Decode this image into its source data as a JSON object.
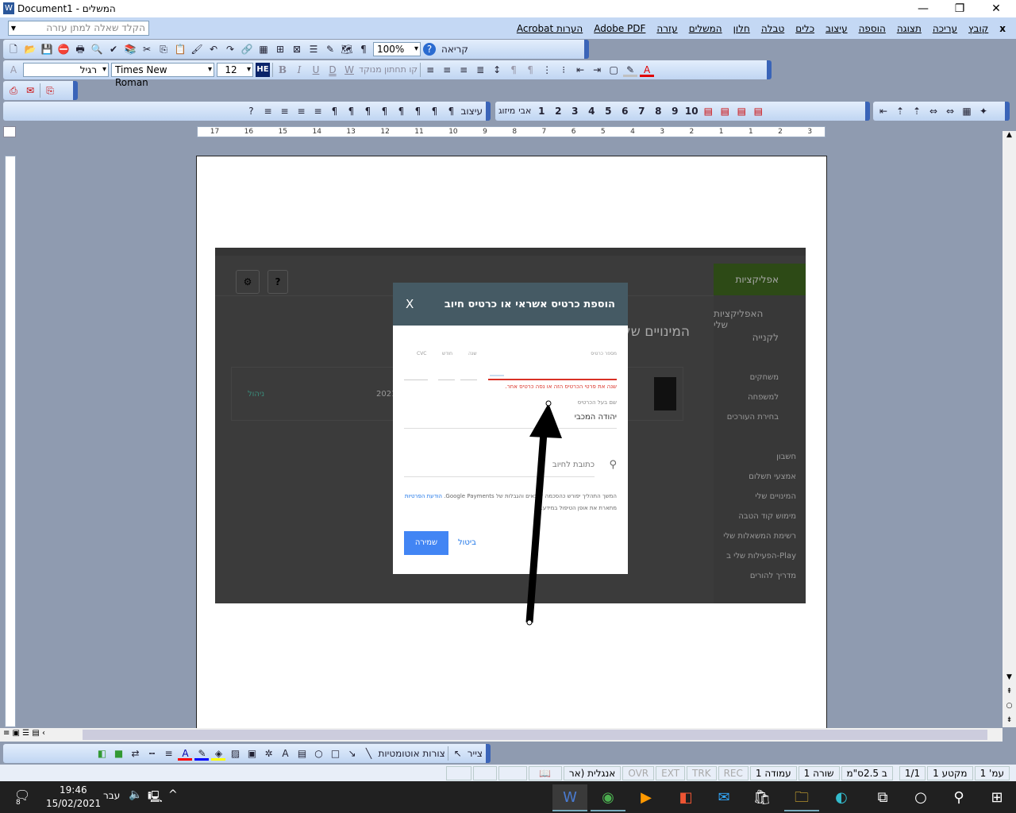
{
  "window": {
    "title": "Document1 - המשלים",
    "minimize": "—",
    "maximize": "❐",
    "close": "✕"
  },
  "menu": {
    "close_doc": "x",
    "items": [
      "קובץ",
      "עריכה",
      "תצוגה",
      "הוספה",
      "עיצוב",
      "כלים",
      "טבלה",
      "חלון",
      "המשלים",
      "עזרה",
      "Adobe PDF",
      "Acrobat הערות"
    ],
    "help_placeholder": "הקלד שאלה למתן עזרה"
  },
  "standard_toolbar": {
    "buttons": [
      {
        "name": "new",
        "g": "🗋"
      },
      {
        "name": "open",
        "g": "📂"
      },
      {
        "name": "save",
        "g": "💾"
      },
      {
        "name": "permission",
        "g": "⛔"
      },
      {
        "name": "print",
        "g": "🖶"
      },
      {
        "name": "print-preview",
        "g": "🔍"
      },
      {
        "name": "spelling",
        "g": "✔"
      },
      {
        "name": "research",
        "g": "📚"
      },
      {
        "name": "cut",
        "g": "✂"
      },
      {
        "name": "copy",
        "g": "⎘"
      },
      {
        "name": "paste",
        "g": "📋"
      },
      {
        "name": "format-painter",
        "g": "🖌"
      },
      {
        "name": "undo",
        "g": "↶"
      },
      {
        "name": "redo",
        "g": "↷"
      },
      {
        "name": "hyperlink",
        "g": "🔗"
      },
      {
        "name": "tables-borders",
        "g": "▦"
      },
      {
        "name": "insert-table",
        "g": "⊞"
      },
      {
        "name": "insert-excel",
        "g": "⊠"
      },
      {
        "name": "columns",
        "g": "☰"
      },
      {
        "name": "drawing",
        "g": "✎"
      },
      {
        "name": "document-map",
        "g": "🗺"
      },
      {
        "name": "show-hide",
        "g": "¶"
      }
    ],
    "zoom": "100%",
    "help": "?",
    "read": "קריאה"
  },
  "formatting_toolbar": {
    "style": "רגיל",
    "font": "Times New Roman",
    "size": "12",
    "language": "HE",
    "bold": "B",
    "italic": "I",
    "underline": "U",
    "double_underline": "D",
    "w": "W",
    "dotted_underline": "קו תחתון מנוקד",
    "font_color": "#e00000",
    "highlight_color": "#c0c0c0"
  },
  "toolbar3": {
    "buttons": [
      "pdf",
      "pdf-email",
      "pdf-review"
    ]
  },
  "toolbar4": {
    "format_label": "עיצוב",
    "mizug_label": "מיזוג",
    "abc_label": "אבי",
    "numbers": [
      "1",
      "2",
      "3",
      "4",
      "5",
      "6",
      "7",
      "8",
      "9",
      "10"
    ]
  },
  "ruler": {
    "ticks": [
      "3",
      "2",
      "1",
      "1",
      "2",
      "3",
      "4",
      "5",
      "6",
      "7",
      "8",
      "9",
      "10",
      "11",
      "12",
      "13",
      "14",
      "15",
      "16",
      "17"
    ]
  },
  "embedded": {
    "sidebar": {
      "apps": "אפליקציות",
      "my_apps": "האפליקציות שלי",
      "buy": "לקנייה",
      "items1": [
        "משחקים",
        "למשפחה",
        "בחירת העורכים"
      ],
      "items2": [
        "חשבון",
        "אמצעי תשלום",
        "המינויים שלי",
        "מימוש קוד הטבה",
        "רשימת המשאלות שלי",
        "הפעילות שלי ב-Play",
        "מדריך להורים"
      ]
    },
    "heading": "המינויים של",
    "row_year": "2021",
    "row_manage": "ניהול",
    "dialog": {
      "close": "X",
      "title": "הוספת כרטיס אשראי או כרטיס חיוב",
      "card_number_label": "מספר כרטיס",
      "year_label": "שנה",
      "month_label": "חודש",
      "cvc_label": "CVC",
      "error": "שנה את פרטי הכרטיס הזה או נסה כרטיס אחר.",
      "holder_label": "שם בעל הכרטיס",
      "holder_value": "יהודה המכבי",
      "address_placeholder": "כתובת לחיוב",
      "terms_1": "המשך התהליך יפורש כהסכמה לתנאים והגבלות של Google Payments.",
      "privacy_link": "הודעת הפרטיות",
      "terms_2": "מתארת את אופן הטיפול במידע.",
      "terms_link": "תנאים והגבלות",
      "cancel": "ביטול",
      "save": "שמירה",
      "error_color": "#d93025",
      "save_color": "#4285f4",
      "header_color": "#455a64"
    }
  },
  "drawing_toolbar": {
    "draw": "צייר",
    "autoshapes": "צורות אוטומטיות",
    "fill_color": "#ffff00",
    "line_color": "#0000ff",
    "font_color": "#ff0000"
  },
  "status": {
    "page": "עמ' 1",
    "section": "מקטע 1",
    "pages": "1/1",
    "at": "ב 2.5ס\"מ",
    "line": "שורה 1",
    "col": "עמודה 1",
    "rec": "REC",
    "trk": "TRK",
    "ext": "EXT",
    "ovr": "OVR",
    "lang": "אנגלית (אר"
  },
  "taskbar": {
    "time": "19:46",
    "date": "15/02/2021",
    "lang": "עבר",
    "notifications": "8",
    "apps": [
      "word",
      "chrome",
      "media-player",
      "office",
      "mail",
      "store",
      "file-explorer",
      "edge",
      "task-view",
      "cortana",
      "search",
      "start"
    ]
  }
}
